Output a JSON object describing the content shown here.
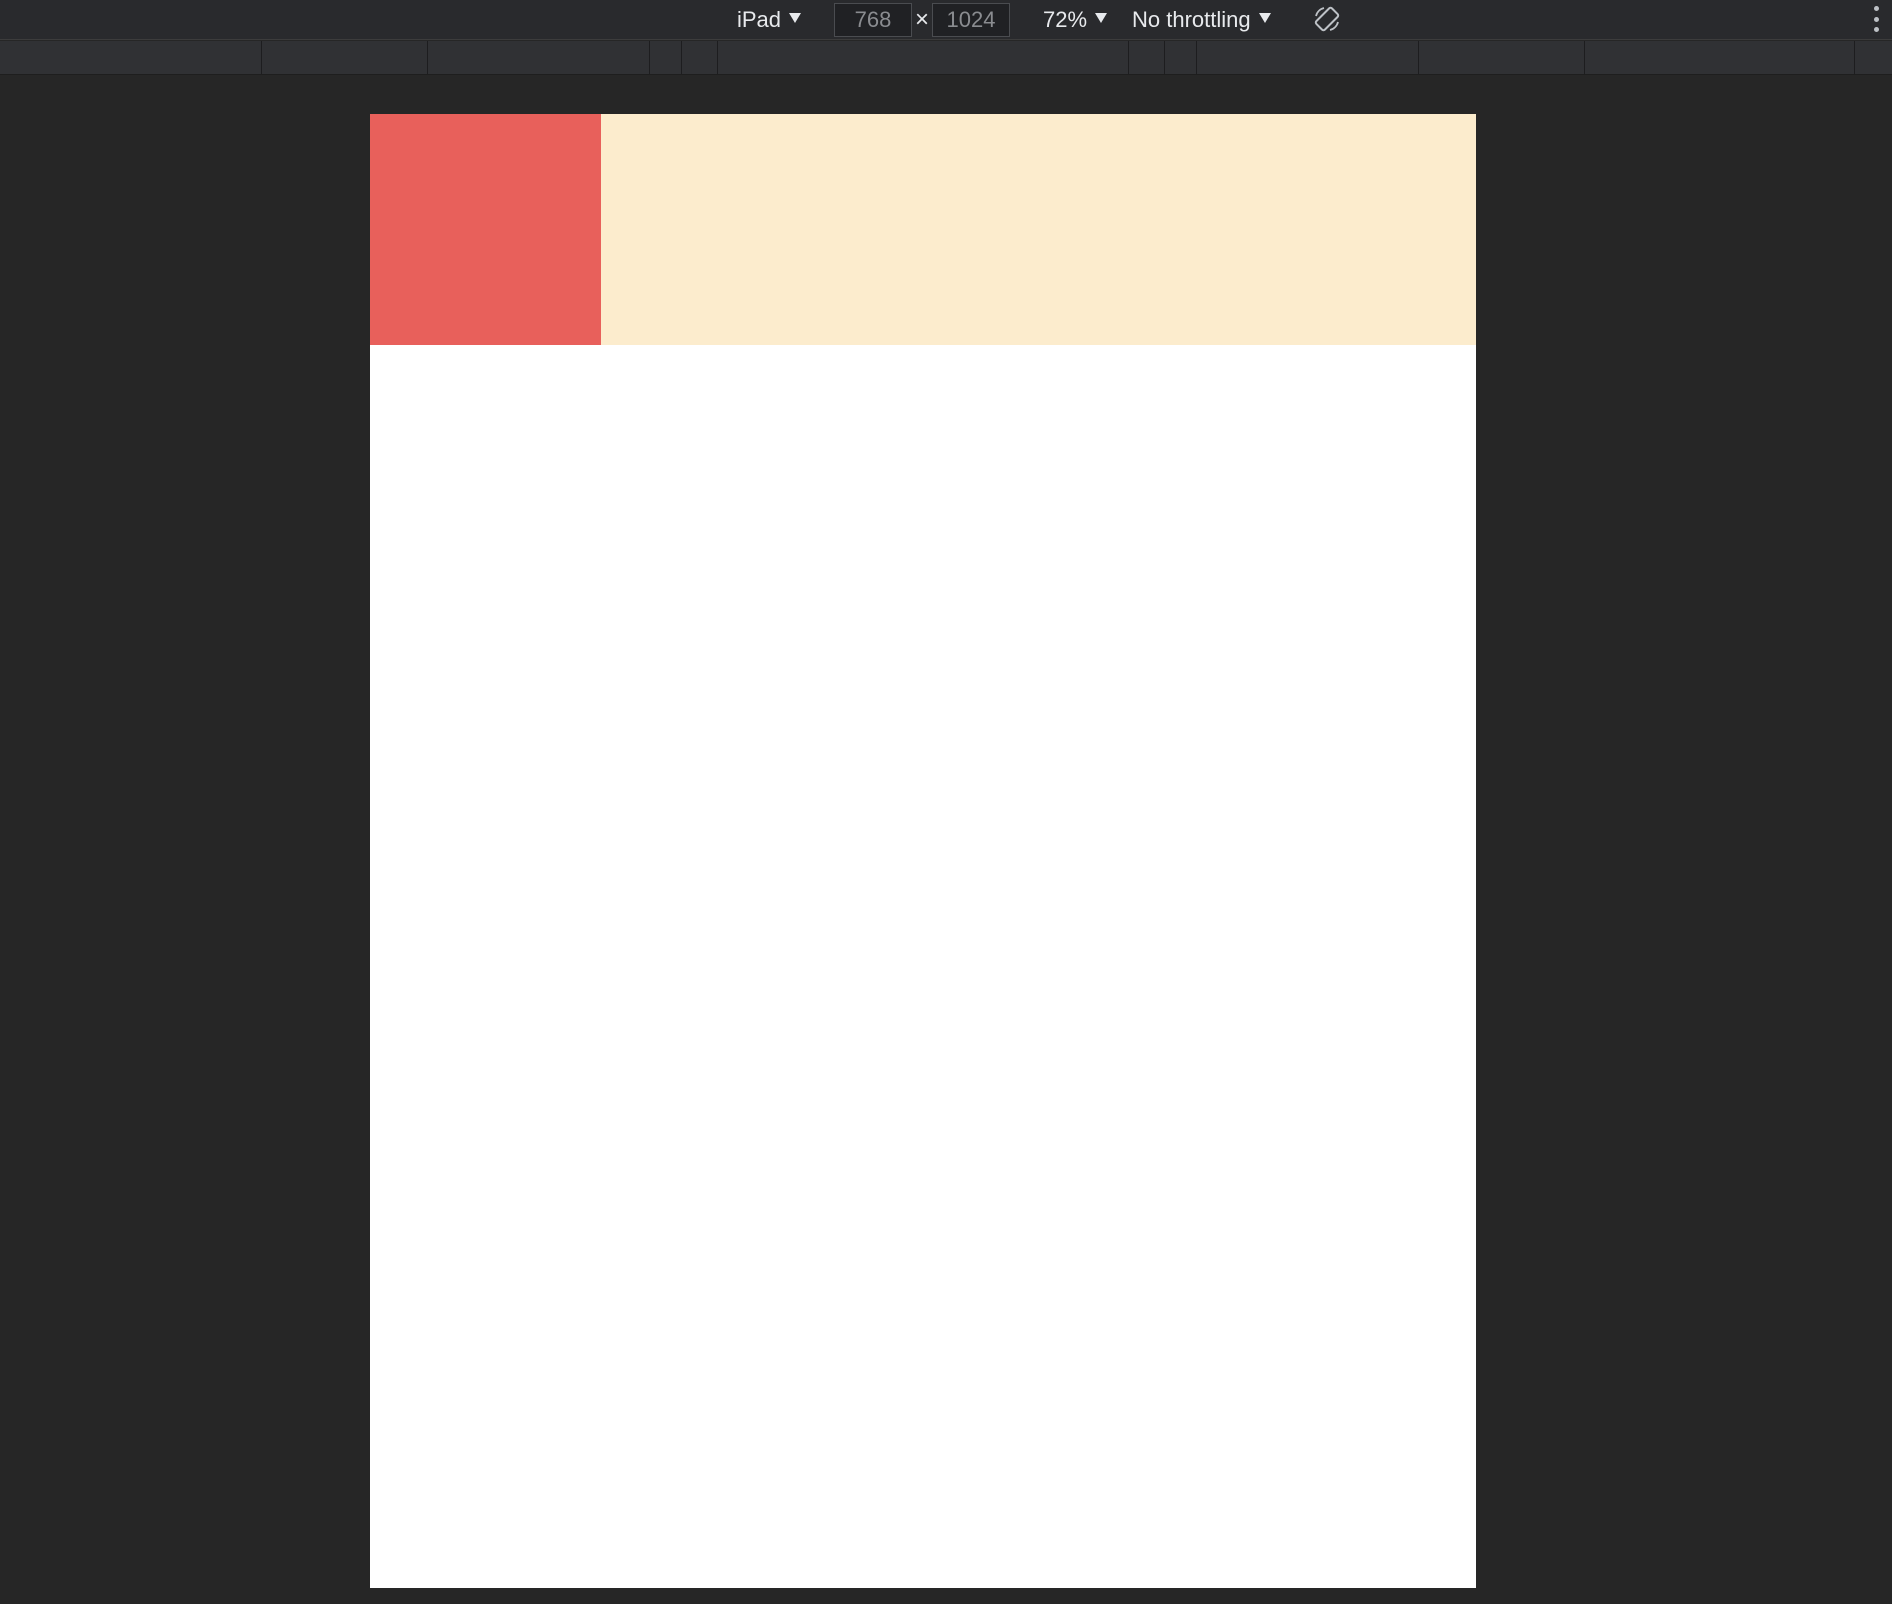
{
  "toolbar": {
    "device": "iPad",
    "width_value": "768",
    "height_value": "1024",
    "times_symbol": "×",
    "zoom": "72%",
    "throttling": "No throttling"
  },
  "icons": {
    "rotate": "rotate-icon",
    "more": "more-options-icon",
    "dropdown": "chevron-down-icon"
  },
  "colors": {
    "background": "#262626",
    "header_red": "#E8605B",
    "header_cream": "#FCECCD",
    "viewport": "#FFFFFF"
  }
}
